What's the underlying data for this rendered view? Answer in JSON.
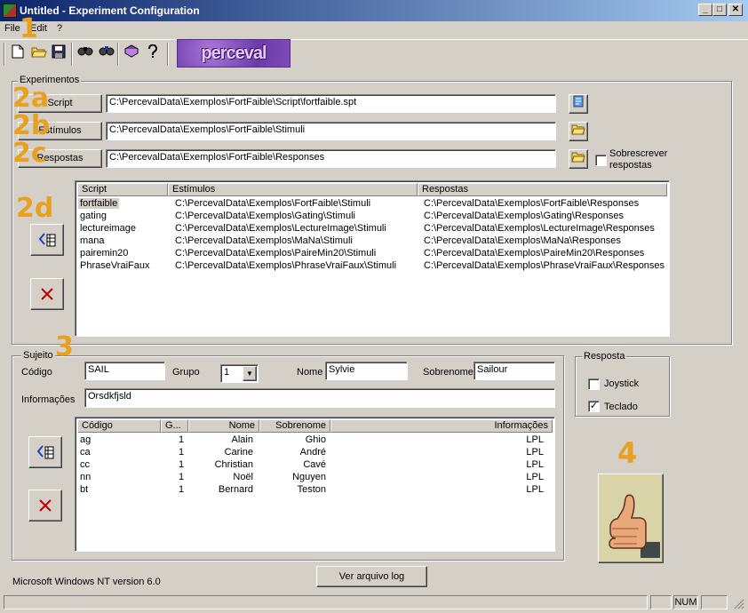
{
  "window": {
    "title": "Untitled - Experiment Configuration",
    "minimize": "_",
    "maximize": "□",
    "close": "✕"
  },
  "menu": {
    "file": "File",
    "edit": "Edit",
    "help": "?"
  },
  "toolbar": {
    "icons": [
      "new-file-icon",
      "open-folder-icon",
      "save-icon",
      "find-icon",
      "find-next-icon",
      "book-icon",
      "help-icon"
    ],
    "logo_text": "perceval"
  },
  "annotations": {
    "n1": "1",
    "n2a": "2a",
    "n2b": "2b",
    "n2c": "2c",
    "n2d": "2d",
    "n3": "3",
    "n4": "4"
  },
  "experimentos": {
    "title": "Experimentos",
    "script_button": "Script",
    "script_path": "C:\\PercevalData\\Exemplos\\FortFaible\\Script\\fortfaible.spt",
    "estimulos_button": "Estímulos",
    "estimulos_path": "C:\\PercevalData\\Exemplos\\FortFaible\\Stimuli",
    "respostas_button": "Respostas",
    "respostas_path": "C:\\PercevalData\\Exemplos\\FortFaible\\Responses",
    "overwrite_label": "Sobrescrever respostas",
    "overwrite_line1": "Sobrescrever",
    "overwrite_line2": "respostas",
    "columns": [
      "Script",
      "Estímulos",
      "Respostas"
    ],
    "rows": [
      {
        "script": "fortfaible",
        "estimulos": "C:\\PercevalData\\Exemplos\\FortFaible\\Stimuli",
        "respostas": "C:\\PercevalData\\Exemplos\\FortFaible\\Responses"
      },
      {
        "script": "gating",
        "estimulos": "C:\\PercevalData\\Exemplos\\Gating\\Stimuli",
        "respostas": "C:\\PercevalData\\Exemplos\\Gating\\Responses"
      },
      {
        "script": "lectureimage",
        "estimulos": "C:\\PercevalData\\Exemplos\\LectureImage\\Stimuli",
        "respostas": "C:\\PercevalData\\Exemplos\\LectureImage\\Responses"
      },
      {
        "script": "mana",
        "estimulos": "C:\\PercevalData\\Exemplos\\MaNa\\Stimuli",
        "respostas": "C:\\PercevalData\\Exemplos\\MaNa\\Responses"
      },
      {
        "script": "pairemin20",
        "estimulos": "C:\\PercevalData\\Exemplos\\PaireMin20\\Stimuli",
        "respostas": "C:\\PercevalData\\Exemplos\\PaireMin20\\Responses"
      },
      {
        "script": "PhraseVraiFaux",
        "estimulos": "C:\\PercevalData\\Exemplos\\PhraseVraiFaux\\Stimuli",
        "respostas": "C:\\PercevalData\\Exemplos\\PhraseVraiFaux\\Responses"
      }
    ]
  },
  "sujeito": {
    "title": "Sujeito",
    "codigo_label": "Código",
    "codigo_value": "SAIL",
    "grupo_label": "Grupo",
    "grupo_value": "1",
    "nome_label": "Nome",
    "nome_value": "Sylvie",
    "sobrenome_label": "Sobrenome",
    "sobrenome_value": "Sailour",
    "informacoes_label": "Informações",
    "informacoes_value": "Orsdkfjsld",
    "columns": [
      "Código",
      "G...",
      "Nome",
      "Sobrenome",
      "Informações"
    ],
    "rows": [
      {
        "codigo": "ag",
        "grupo": "1",
        "nome": "Alain",
        "sobrenome": "Ghio",
        "info": "LPL"
      },
      {
        "codigo": "ca",
        "grupo": "1",
        "nome": "Carine",
        "sobrenome": "André",
        "info": "LPL"
      },
      {
        "codigo": "cc",
        "grupo": "1",
        "nome": "Christian",
        "sobrenome": "Cavé",
        "info": "LPL"
      },
      {
        "codigo": "nn",
        "grupo": "1",
        "nome": "Noël",
        "sobrenome": "Nguyen",
        "info": "LPL"
      },
      {
        "codigo": "bt",
        "grupo": "1",
        "nome": "Bernard",
        "sobrenome": "Teston",
        "info": "LPL"
      }
    ]
  },
  "resposta": {
    "title": "Resposta",
    "joystick_label": "Joystick",
    "joystick_checked": false,
    "teclado_label": "Teclado",
    "teclado_checked": true
  },
  "footer": {
    "os_version": "Microsoft Windows NT version 6.0",
    "log_button": "Ver arquivo log"
  },
  "statusbar": {
    "num": "NUM"
  },
  "colors": {
    "title_gradient_start": "#0a246a",
    "title_gradient_end": "#a6caf0",
    "annotation_orange": "#e8a020",
    "window_bg": "#d4d0c8"
  }
}
